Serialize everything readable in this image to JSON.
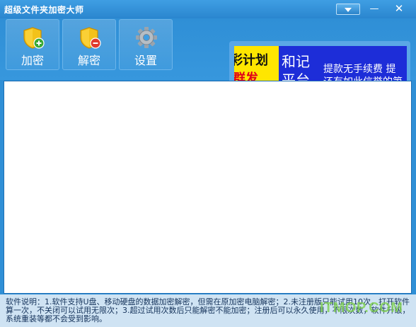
{
  "window": {
    "title": "超级文件夹加密大师"
  },
  "toolbar": {
    "encrypt_label": "加密",
    "decrypt_label": "解密",
    "settings_label": "设置"
  },
  "banner": {
    "yellow_line1": "彩计划",
    "yellow_line2": "群发",
    "blue_line1": "和记",
    "blue_line2": "平台",
    "blue_line3": "提款无手续费 提",
    "blue_line4": "还有如此信誉的第"
  },
  "footer": {
    "note": "软件说明：1.软件支持U盘、移动硬盘的数据加密解密，但需在原加密电脑解密；2.未注册版只能试用10次，打开软件算一次，不关闭可以试用无限次；3.超过试用次数后只能解密不能加密；注册后可以永久使用，不限次数，软件升级，系统重装等都不会受到影响。"
  },
  "watermark": "ITMOP.COM",
  "colors": {
    "window_blue": "#2f8fd6",
    "ad_blue": "#1d2dd8",
    "ad_yellow": "#ffe600",
    "ad_red": "#e0001a"
  }
}
